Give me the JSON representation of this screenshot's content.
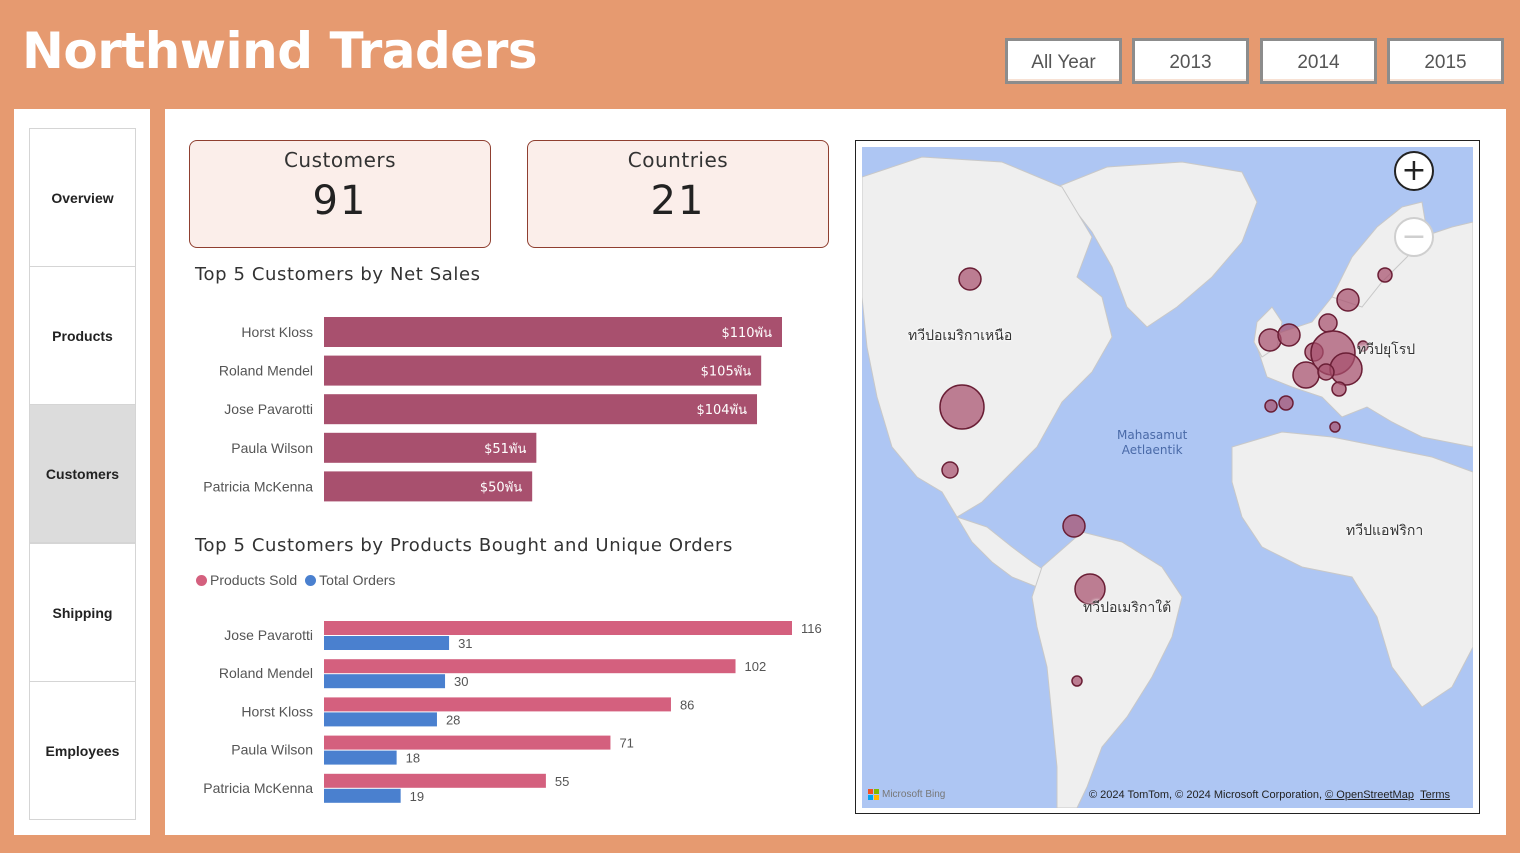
{
  "app": {
    "title": "Northwind Traders"
  },
  "year_filters": [
    "All Year",
    "2013",
    "2014",
    "2015"
  ],
  "nav": {
    "items": [
      "Overview",
      "Products",
      "Customers",
      "Shipping",
      "Employees"
    ],
    "active": "Customers"
  },
  "kpis": {
    "customers": {
      "label": "Customers",
      "value": "91"
    },
    "countries": {
      "label": "Countries",
      "value": "21"
    }
  },
  "net_sales_chart": {
    "title": "Top 5 Customers by Net Sales"
  },
  "products_orders_chart": {
    "title": "Top 5 Customers by Products Bought and Unique Orders",
    "legend": [
      "Products Sold",
      "Total Orders"
    ]
  },
  "colors": {
    "net_sales_bar": "#a8506e",
    "products_sold": "#d4607e",
    "total_orders": "#4a80cf",
    "map_bubble": "#a8506e"
  },
  "chart_data": [
    {
      "type": "bar",
      "orientation": "horizontal",
      "title": "Top 5 Customers by Net Sales",
      "categories": [
        "Horst Kloss",
        "Roland Mendel",
        "Jose Pavarotti",
        "Paula Wilson",
        "Patricia McKenna"
      ],
      "values": [
        110,
        105,
        104,
        51,
        50
      ],
      "data_labels": [
        "$110พัน",
        "$105พัน",
        "$104พัน",
        "$51พัน",
        "$50พัน"
      ],
      "xlabel": "",
      "ylabel": "",
      "grid": false
    },
    {
      "type": "bar",
      "orientation": "horizontal",
      "title": "Top 5 Customers by Products Bought and Unique Orders",
      "categories": [
        "Jose Pavarotti",
        "Roland Mendel",
        "Horst Kloss",
        "Paula Wilson",
        "Patricia McKenna"
      ],
      "series": [
        {
          "name": "Products Sold",
          "values": [
            116,
            102,
            86,
            71,
            55
          ]
        },
        {
          "name": "Total Orders",
          "values": [
            31,
            30,
            28,
            18,
            19
          ]
        }
      ],
      "legend_position": "top-left",
      "xlabel": "",
      "ylabel": "",
      "grid": false
    }
  ],
  "map": {
    "continent_labels": {
      "north_america": "ทวีปอเมริกาเหนือ",
      "europe": "ทวีปยุโรป",
      "africa": "ทวีปแอฟริกา",
      "south_america": "ทวีปอเมริกาใต้"
    },
    "ocean_label": [
      "Mahasamut",
      "Aetlaentik"
    ],
    "attribution": "© 2024 TomTom, © 2024 Microsoft Corporation,",
    "osm_link": "© OpenStreetMap",
    "terms_link": "Terms",
    "provider": "Microsoft Bing",
    "zoom_in_icon": "plus-icon",
    "zoom_out_icon": "minus-icon"
  }
}
